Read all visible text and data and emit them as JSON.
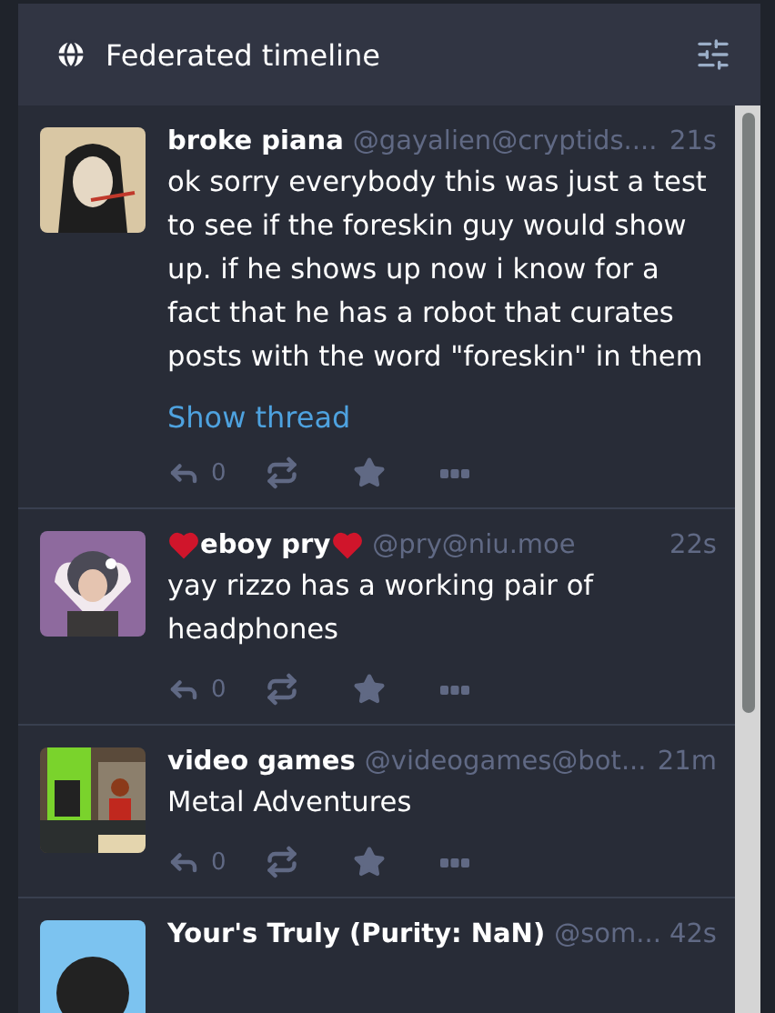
{
  "column": {
    "title": "Federated timeline"
  },
  "posts": [
    {
      "display_name": "broke piana",
      "hearts": false,
      "handle": "@gayalien@cryptids....",
      "time": "21s",
      "content": "ok sorry everybody this was just a test to see if the foreskin guy would show up. if he shows up now i know for a fact that he has a robot that curates posts with the word \"foreskin\" in them",
      "thread_link": "Show thread",
      "replies": "0"
    },
    {
      "display_name": "eboy pry",
      "hearts": true,
      "handle": "@pry@niu.moe",
      "time": "22s",
      "content": "yay rizzo has a working pair of headphones",
      "replies": "0"
    },
    {
      "display_name": "video games",
      "hearts": false,
      "handle": "@videogames@bot...",
      "time": "21m",
      "content": "Metal Adventures",
      "replies": "0"
    },
    {
      "display_name": "Your's Truly (Purity: NaN)",
      "hearts": false,
      "handle": "@som...",
      "time": "42s"
    }
  ]
}
